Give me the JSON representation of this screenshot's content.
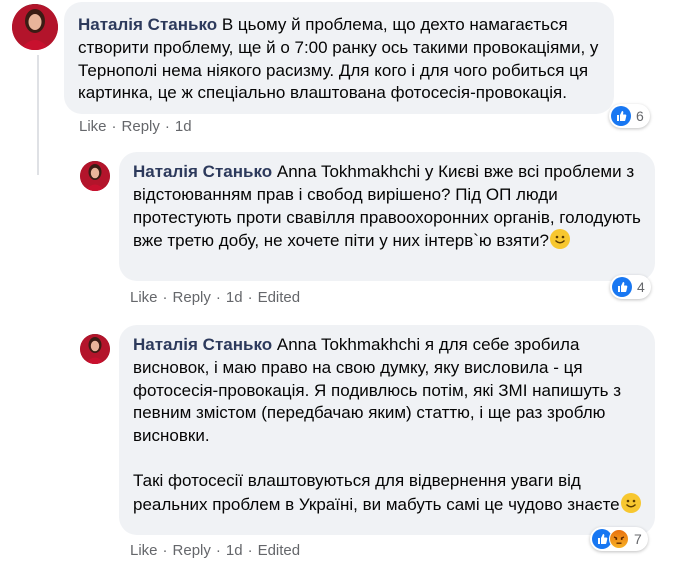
{
  "comments": [
    {
      "author": "Наталія Станько",
      "text_first": "В цьому й проблема, що дехто намагається",
      "text_rest": "створити проблему, ще й о 7:00 ранку ось такими провокаціями, у Тернополі нема ніякого расизму. Для кого і для чого робиться ця картинка, це ж спеціально влаштована фотосесія-провокація.",
      "actions": {
        "like": "Like",
        "reply": "Reply",
        "time": "1d"
      },
      "reaction_count": "6"
    },
    {
      "author": "Наталія Станько",
      "text": "Anna Tokhmakhchi у Києві вже всі проблеми з відстоюванням прав і свобод вирішено? Під ОП люди протестують проти свавілля правоохоронних органів, голодують вже третю добу, не хочете піти у них інтерв`ю взяти?",
      "actions": {
        "like": "Like",
        "reply": "Reply",
        "time": "1d",
        "edited": "Edited"
      },
      "reaction_count": "4"
    },
    {
      "author": "Наталія Станько",
      "text": "Anna Tokhmakhchi я для себе зробила висновок, і маю право на свою думку, яку висловила - ця фотосесія-провокація. Я подивлюсь потім, які ЗМІ напишуть з певним змістом (передбачаю яким) статтю, і ще раз зроблю висновки.",
      "text2": "Такі фотосесії влаштовуються для відвернення уваги від реальних проблем в Україні, ви мабуть самі це чудово знаєте",
      "actions": {
        "like": "Like",
        "reply": "Reply",
        "time": "1d",
        "edited": "Edited"
      },
      "reaction_count": "7"
    }
  ],
  "colors": {
    "bubble": "#f0f2f5",
    "author": "#2d3a5c",
    "meta": "#65676b",
    "like": "#1877f2"
  },
  "icons": [
    "avatar",
    "like-icon",
    "angry-icon",
    "smile-emoji"
  ]
}
